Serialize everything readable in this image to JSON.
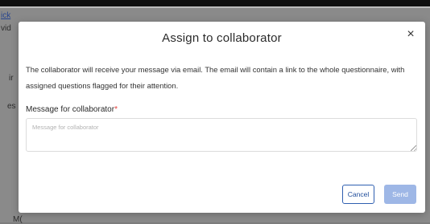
{
  "background": {
    "link_fragment": "ick",
    "fragment_1": "vid",
    "fragment_2": "ir",
    "fragment_3": "es",
    "fragment_4": "M(",
    "overlay_color": "#8a8a8a"
  },
  "modal": {
    "title": "Assign to collaborator",
    "close_icon": "close-icon",
    "close_glyph": "×",
    "description": "The collaborator will receive your message via email. The email will contain a link to the whole questionnaire, with assigned questions flagged for their attention.",
    "field_label": "Message for collaborator",
    "required_marker": "*",
    "message_value": "",
    "message_placeholder": "Message for collaborator",
    "cancel_label": "Cancel",
    "send_label": "Send",
    "send_enabled": false
  },
  "colors": {
    "primary": "#2f5fb0",
    "send_disabled": "#9eb7e6",
    "required": "#e53935"
  }
}
